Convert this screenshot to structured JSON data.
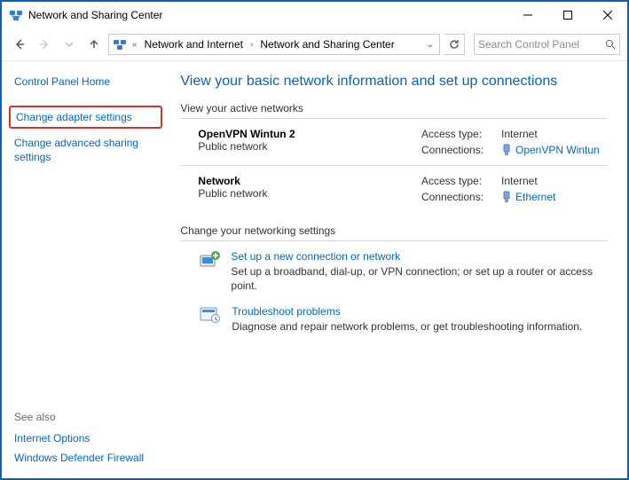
{
  "window": {
    "title": "Network and Sharing Center"
  },
  "breadcrumb": {
    "sep0": "«",
    "part1": "Network and Internet",
    "sep1": "›",
    "part2": "Network and Sharing Center",
    "drop": "⌄"
  },
  "search": {
    "placeholder": "Search Control Panel"
  },
  "sidebar": {
    "home": "Control Panel Home",
    "adapter": "Change adapter settings",
    "advanced": "Change advanced sharing settings",
    "see_also": "See also",
    "internet_options": "Internet Options",
    "firewall": "Windows Defender Firewall"
  },
  "main": {
    "title": "View your basic network information and set up connections",
    "active_label": "View your active networks",
    "net1": {
      "name": "OpenVPN Wintun 2",
      "type": "Public network",
      "access_lbl": "Access type:",
      "access_val": "Internet",
      "conn_lbl": "Connections:",
      "conn_val": "OpenVPN Wintun"
    },
    "net2": {
      "name": "Network",
      "type": "Public network",
      "access_lbl": "Access type:",
      "access_val": "Internet",
      "conn_lbl": "Connections:",
      "conn_val": "Ethernet"
    },
    "change_label": "Change your networking settings",
    "setup": {
      "link": "Set up a new connection or network",
      "desc": "Set up a broadband, dial-up, or VPN connection; or set up a router or access point."
    },
    "troubleshoot": {
      "link": "Troubleshoot problems",
      "desc": "Diagnose and repair network problems, or get troubleshooting information."
    }
  }
}
